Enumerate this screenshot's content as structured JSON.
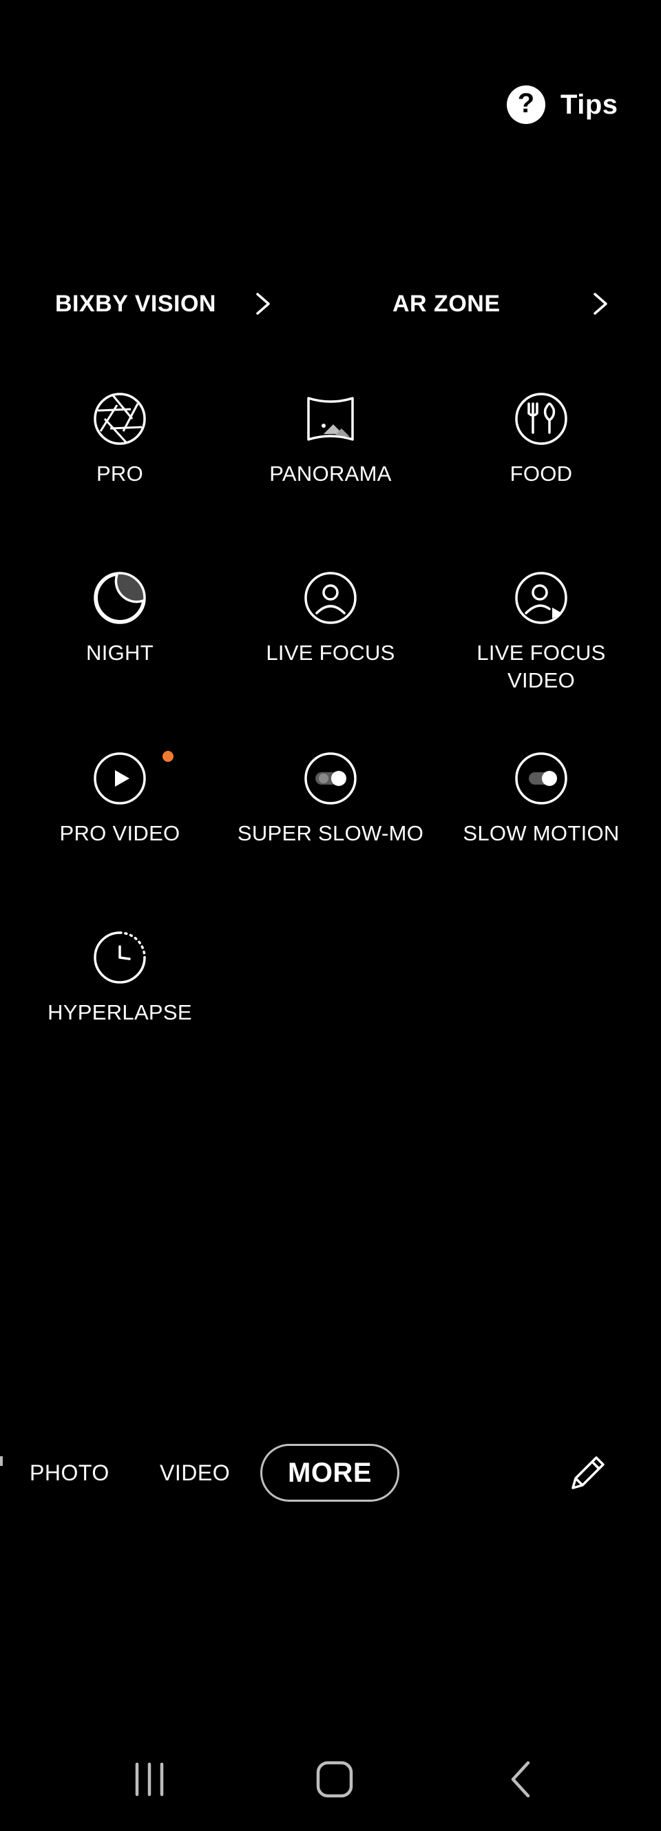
{
  "tips": {
    "label": "Tips",
    "icon": "help-circle-icon"
  },
  "links": {
    "bixby_vision": "BIXBY VISION",
    "ar_zone": "AR ZONE"
  },
  "modes": [
    {
      "label": "PRO",
      "icon": "aperture-icon"
    },
    {
      "label": "PANORAMA",
      "icon": "panorama-icon"
    },
    {
      "label": "FOOD",
      "icon": "food-icon"
    },
    {
      "label": "NIGHT",
      "icon": "night-moon-icon"
    },
    {
      "label": "LIVE FOCUS",
      "icon": "person-icon"
    },
    {
      "label": "LIVE FOCUS VIDEO",
      "icon": "person-play-icon"
    },
    {
      "label": "PRO VIDEO",
      "icon": "play-icon",
      "badge_color": "#f07a30"
    },
    {
      "label": "SUPER SLOW-MO",
      "icon": "toggle-icon"
    },
    {
      "label": "SLOW MOTION",
      "icon": "toggle-icon"
    },
    {
      "label": "HYPERLAPSE",
      "icon": "timer-icon"
    }
  ],
  "tabs": {
    "photo": "PHOTO",
    "video": "VIDEO",
    "more": "MORE"
  },
  "colors": {
    "background": "#000000",
    "text": "#ffffff",
    "badge": "#f07a30",
    "pill_border": "#bfbfbf"
  }
}
